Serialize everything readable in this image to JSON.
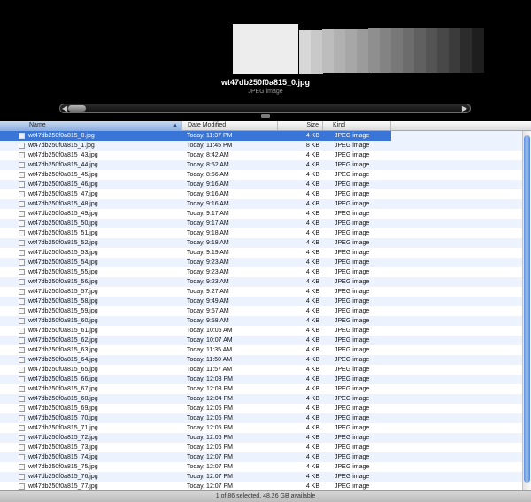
{
  "preview": {
    "title": "wt47db250f0a815_0.jpg",
    "kind": "JPEG image",
    "stack_colors": [
      "#d7d7d7",
      "#c9c9c9",
      "#bdbdbd",
      "#b1b1b1",
      "#a7a7a7",
      "#9b9b9b",
      "#8f8f8f",
      "#838383",
      "#787878",
      "#6c6c6c",
      "#606060",
      "#545454",
      "#484848",
      "#3b3b3b",
      "#2c2c2c",
      "#1e1e1e"
    ]
  },
  "columns": {
    "name": "Name",
    "date": "Date Modified",
    "size": "Size",
    "kind": "Kind"
  },
  "files": [
    {
      "name": "wt47db250f0a815_0.jpg",
      "date": "Today, 11:37 PM",
      "size": "4 KB",
      "kind": "JPEG image",
      "selected": true
    },
    {
      "name": "wt47db250f0a815_1.jpg",
      "date": "Today, 11:45 PM",
      "size": "8 KB",
      "kind": "JPEG image"
    },
    {
      "name": "wt47db250f0a815_43.jpg",
      "date": "Today, 8:42 AM",
      "size": "4 KB",
      "kind": "JPEG image"
    },
    {
      "name": "wt47db250f0a815_44.jpg",
      "date": "Today, 8:52 AM",
      "size": "4 KB",
      "kind": "JPEG image"
    },
    {
      "name": "wt47db250f0a815_45.jpg",
      "date": "Today, 8:56 AM",
      "size": "4 KB",
      "kind": "JPEG image"
    },
    {
      "name": "wt47db250f0a815_46.jpg",
      "date": "Today, 9:16 AM",
      "size": "4 KB",
      "kind": "JPEG image"
    },
    {
      "name": "wt47db250f0a815_47.jpg",
      "date": "Today, 9:16 AM",
      "size": "4 KB",
      "kind": "JPEG image"
    },
    {
      "name": "wt47db250f0a815_48.jpg",
      "date": "Today, 9:16 AM",
      "size": "4 KB",
      "kind": "JPEG image"
    },
    {
      "name": "wt47db250f0a815_49.jpg",
      "date": "Today, 9:17 AM",
      "size": "4 KB",
      "kind": "JPEG image"
    },
    {
      "name": "wt47db250f0a815_50.jpg",
      "date": "Today, 9:17 AM",
      "size": "4 KB",
      "kind": "JPEG image"
    },
    {
      "name": "wt47db250f0a815_51.jpg",
      "date": "Today, 9:18 AM",
      "size": "4 KB",
      "kind": "JPEG image"
    },
    {
      "name": "wt47db250f0a815_52.jpg",
      "date": "Today, 9:18 AM",
      "size": "4 KB",
      "kind": "JPEG image"
    },
    {
      "name": "wt47db250f0a815_53.jpg",
      "date": "Today, 9:19 AM",
      "size": "4 KB",
      "kind": "JPEG image"
    },
    {
      "name": "wt47db250f0a815_54.jpg",
      "date": "Today, 9:23 AM",
      "size": "4 KB",
      "kind": "JPEG image"
    },
    {
      "name": "wt47db250f0a815_55.jpg",
      "date": "Today, 9:23 AM",
      "size": "4 KB",
      "kind": "JPEG image"
    },
    {
      "name": "wt47db250f0a815_56.jpg",
      "date": "Today, 9:23 AM",
      "size": "4 KB",
      "kind": "JPEG image"
    },
    {
      "name": "wt47db250f0a815_57.jpg",
      "date": "Today, 9:27 AM",
      "size": "4 KB",
      "kind": "JPEG image"
    },
    {
      "name": "wt47db250f0a815_58.jpg",
      "date": "Today, 9:49 AM",
      "size": "4 KB",
      "kind": "JPEG image"
    },
    {
      "name": "wt47db250f0a815_59.jpg",
      "date": "Today, 9:57 AM",
      "size": "4 KB",
      "kind": "JPEG image"
    },
    {
      "name": "wt47db250f0a815_60.jpg",
      "date": "Today, 9:58 AM",
      "size": "4 KB",
      "kind": "JPEG image"
    },
    {
      "name": "wt47db250f0a815_61.jpg",
      "date": "Today, 10:05 AM",
      "size": "4 KB",
      "kind": "JPEG image"
    },
    {
      "name": "wt47db250f0a815_62.jpg",
      "date": "Today, 10:07 AM",
      "size": "4 KB",
      "kind": "JPEG image"
    },
    {
      "name": "wt47db250f0a815_63.jpg",
      "date": "Today, 11:35 AM",
      "size": "4 KB",
      "kind": "JPEG image"
    },
    {
      "name": "wt47db250f0a815_64.jpg",
      "date": "Today, 11:50 AM",
      "size": "4 KB",
      "kind": "JPEG image"
    },
    {
      "name": "wt47db250f0a815_65.jpg",
      "date": "Today, 11:57 AM",
      "size": "4 KB",
      "kind": "JPEG image"
    },
    {
      "name": "wt47db250f0a815_66.jpg",
      "date": "Today, 12:03 PM",
      "size": "4 KB",
      "kind": "JPEG image"
    },
    {
      "name": "wt47db250f0a815_67.jpg",
      "date": "Today, 12:03 PM",
      "size": "4 KB",
      "kind": "JPEG image"
    },
    {
      "name": "wt47db250f0a815_68.jpg",
      "date": "Today, 12:04 PM",
      "size": "4 KB",
      "kind": "JPEG image"
    },
    {
      "name": "wt47db250f0a815_69.jpg",
      "date": "Today, 12:05 PM",
      "size": "4 KB",
      "kind": "JPEG image"
    },
    {
      "name": "wt47db250f0a815_70.jpg",
      "date": "Today, 12:05 PM",
      "size": "4 KB",
      "kind": "JPEG image"
    },
    {
      "name": "wt47db250f0a815_71.jpg",
      "date": "Today, 12:05 PM",
      "size": "4 KB",
      "kind": "JPEG image"
    },
    {
      "name": "wt47db250f0a815_72.jpg",
      "date": "Today, 12:06 PM",
      "size": "4 KB",
      "kind": "JPEG image"
    },
    {
      "name": "wt47db250f0a815_73.jpg",
      "date": "Today, 12:06 PM",
      "size": "4 KB",
      "kind": "JPEG image"
    },
    {
      "name": "wt47db250f0a815_74.jpg",
      "date": "Today, 12:07 PM",
      "size": "4 KB",
      "kind": "JPEG image"
    },
    {
      "name": "wt47db250f0a815_75.jpg",
      "date": "Today, 12:07 PM",
      "size": "4 KB",
      "kind": "JPEG image"
    },
    {
      "name": "wt47db250f0a815_76.jpg",
      "date": "Today, 12:07 PM",
      "size": "4 KB",
      "kind": "JPEG image"
    },
    {
      "name": "wt47db250f0a815_77.jpg",
      "date": "Today, 12:07 PM",
      "size": "4 KB",
      "kind": "JPEG image"
    }
  ],
  "status": {
    "text": "1 of 86 selected, 48.26 GB available"
  },
  "icons": {
    "sort": "sort-ascending-icon",
    "file": "jpeg-file-icon",
    "scroll_left": "scroll-left-arrow-icon",
    "scroll_right": "scroll-right-arrow-icon"
  },
  "colors": {
    "selection": "#3875d7",
    "stripe": "#edf3fe",
    "coverflow_bg": "#000000"
  }
}
